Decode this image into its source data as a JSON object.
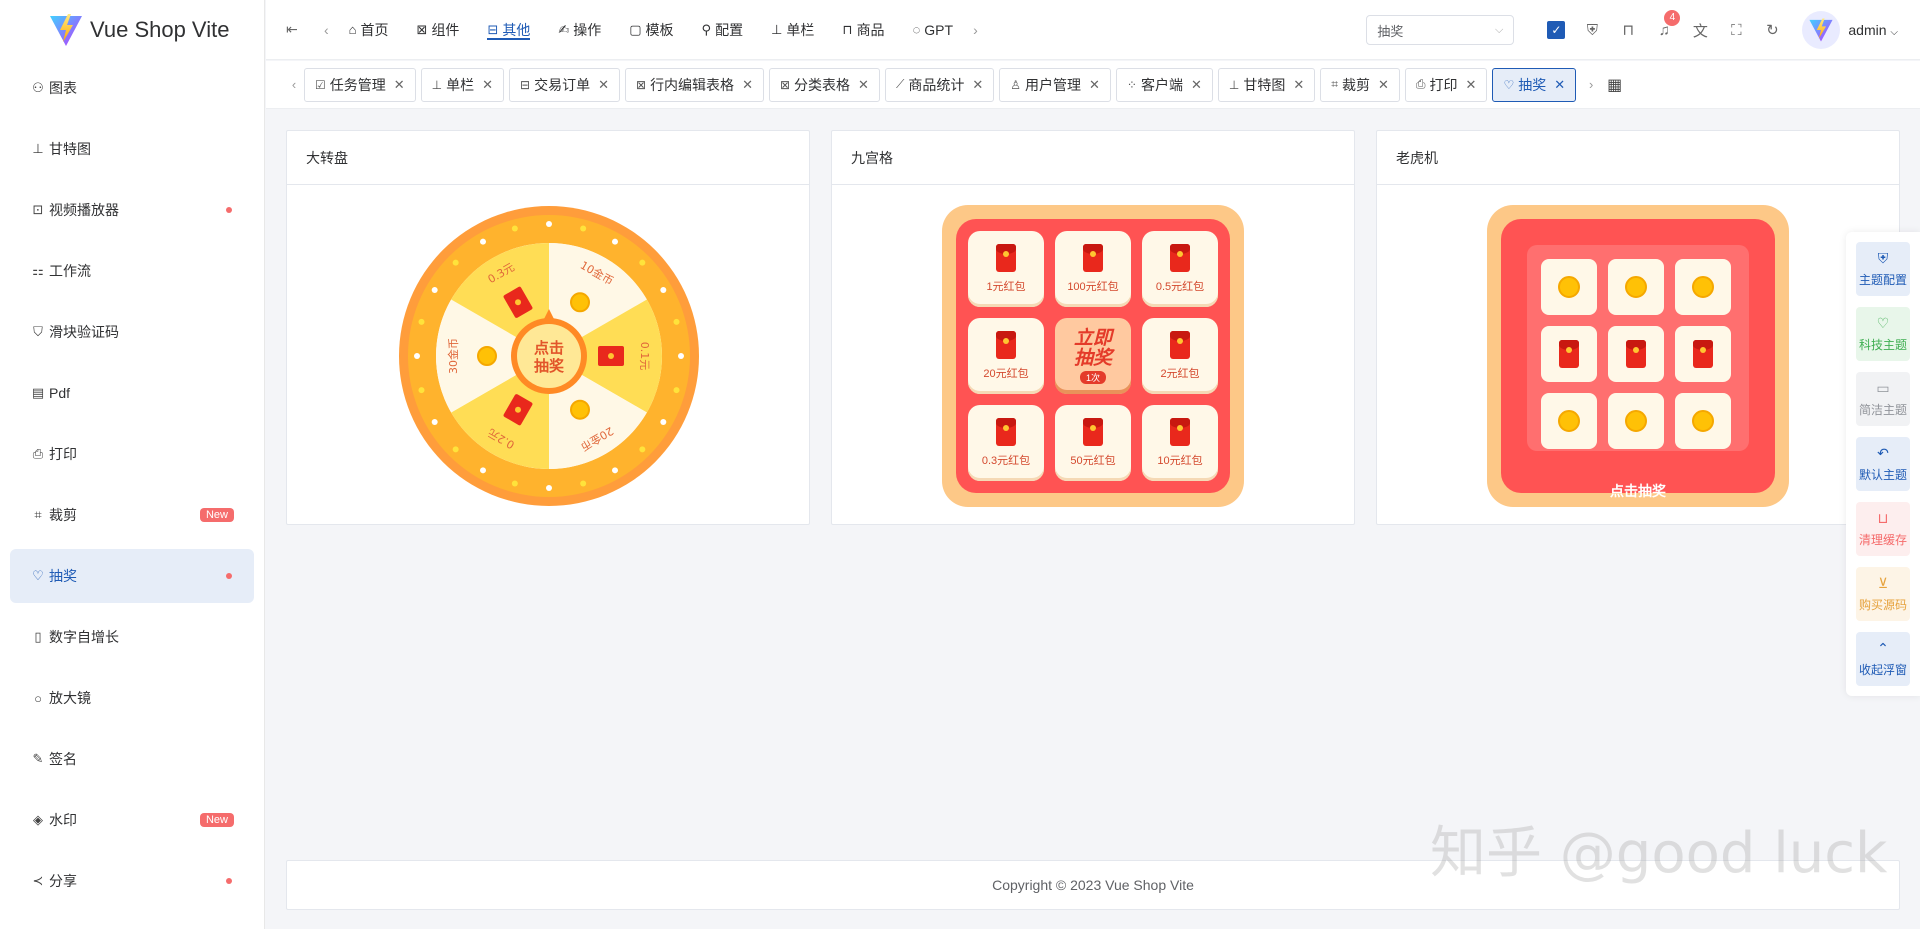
{
  "app": {
    "title": "Vue Shop Vite"
  },
  "sidebar": {
    "items": [
      {
        "label": "图表",
        "icon": "chart-icon",
        "marker": ""
      },
      {
        "label": "甘特图",
        "icon": "gantt-icon",
        "marker": ""
      },
      {
        "label": "视频播放器",
        "icon": "video-icon",
        "marker": "dot"
      },
      {
        "label": "工作流",
        "icon": "workflow-icon",
        "marker": ""
      },
      {
        "label": "滑块验证码",
        "icon": "shield-icon",
        "marker": ""
      },
      {
        "label": "Pdf",
        "icon": "pdf-icon",
        "marker": ""
      },
      {
        "label": "打印",
        "icon": "printer-icon",
        "marker": ""
      },
      {
        "label": "裁剪",
        "icon": "crop-icon",
        "marker": "new"
      },
      {
        "label": "抽奖",
        "icon": "lottery-icon",
        "marker": "dot",
        "active": true
      },
      {
        "label": "数字自增长",
        "icon": "counter-icon",
        "marker": ""
      },
      {
        "label": "放大镜",
        "icon": "magnifier-icon",
        "marker": ""
      },
      {
        "label": "签名",
        "icon": "signature-icon",
        "marker": ""
      },
      {
        "label": "水印",
        "icon": "watermark-icon",
        "marker": "new"
      },
      {
        "label": "分享",
        "icon": "share-icon",
        "marker": "dot"
      }
    ],
    "new_badge": "New"
  },
  "header": {
    "nav": [
      {
        "label": "首页",
        "icon": "home-icon"
      },
      {
        "label": "组件",
        "icon": "component-icon"
      },
      {
        "label": "其他",
        "icon": "other-icon",
        "active": true
      },
      {
        "label": "操作",
        "icon": "operation-icon"
      },
      {
        "label": "模板",
        "icon": "template-icon"
      },
      {
        "label": "配置",
        "icon": "config-icon"
      },
      {
        "label": "单栏",
        "icon": "column-icon"
      },
      {
        "label": "商品",
        "icon": "goods-icon"
      },
      {
        "label": "GPT",
        "icon": "gpt-icon"
      }
    ],
    "search": {
      "value": "抽奖"
    },
    "notification_count": "4",
    "user": "admin"
  },
  "tabs": [
    {
      "label": "任务管理",
      "icon": "task-icon"
    },
    {
      "label": "单栏",
      "icon": "column-icon"
    },
    {
      "label": "交易订单",
      "icon": "order-icon"
    },
    {
      "label": "行内编辑表格",
      "icon": "table-edit-icon"
    },
    {
      "label": "分类表格",
      "icon": "table-icon"
    },
    {
      "label": "商品统计",
      "icon": "stats-icon"
    },
    {
      "label": "用户管理",
      "icon": "user-icon"
    },
    {
      "label": "客户端",
      "icon": "client-icon"
    },
    {
      "label": "甘特图",
      "icon": "gantt-icon"
    },
    {
      "label": "裁剪",
      "icon": "crop-icon"
    },
    {
      "label": "打印",
      "icon": "printer-icon"
    },
    {
      "label": "抽奖",
      "icon": "lottery-icon",
      "active": true
    }
  ],
  "cards": {
    "wheel": {
      "title": "大转盘",
      "prizes": [
        "10金币",
        "0.1元",
        "20金币",
        "0.2元",
        "30金币",
        "0.3元"
      ],
      "center": [
        "点击",
        "抽奖"
      ]
    },
    "grid": {
      "title": "九宫格",
      "prizes": [
        "1元红包",
        "100元红包",
        "0.5元红包",
        "20元红包",
        "",
        "2元红包",
        "0.3元红包",
        "50元红包",
        "10元红包"
      ],
      "center": [
        "立即",
        "抽奖"
      ],
      "times": "1次"
    },
    "slot": {
      "title": "老虎机",
      "button": "点击抽奖"
    }
  },
  "footer": {
    "text": "Copyright © 2023 Vue Shop Vite"
  },
  "float_panel": [
    {
      "label": "主题配置",
      "icon": "shirt-icon",
      "color": "#1f5bb5",
      "bg": "#e6edf8"
    },
    {
      "label": "科技主题",
      "icon": "bulb-icon",
      "color": "#3fae52",
      "bg": "#e8f6ea"
    },
    {
      "label": "简洁主题",
      "icon": "monitor-icon",
      "color": "#909399",
      "bg": "#f1f2f4"
    },
    {
      "label": "默认主题",
      "icon": "undo-icon",
      "color": "#1f5bb5",
      "bg": "#e6edf8"
    },
    {
      "label": "清理缓存",
      "icon": "trash-icon",
      "color": "#f56c6c",
      "bg": "#fdeeee"
    },
    {
      "label": "购买源码",
      "icon": "cart-icon",
      "color": "#e6a23c",
      "bg": "#fdf4e6"
    },
    {
      "label": "收起浮窗",
      "icon": "collapse-icon",
      "color": "#1f5bb5",
      "bg": "#e6edf8"
    }
  ],
  "watermark": "知乎 @good luck"
}
